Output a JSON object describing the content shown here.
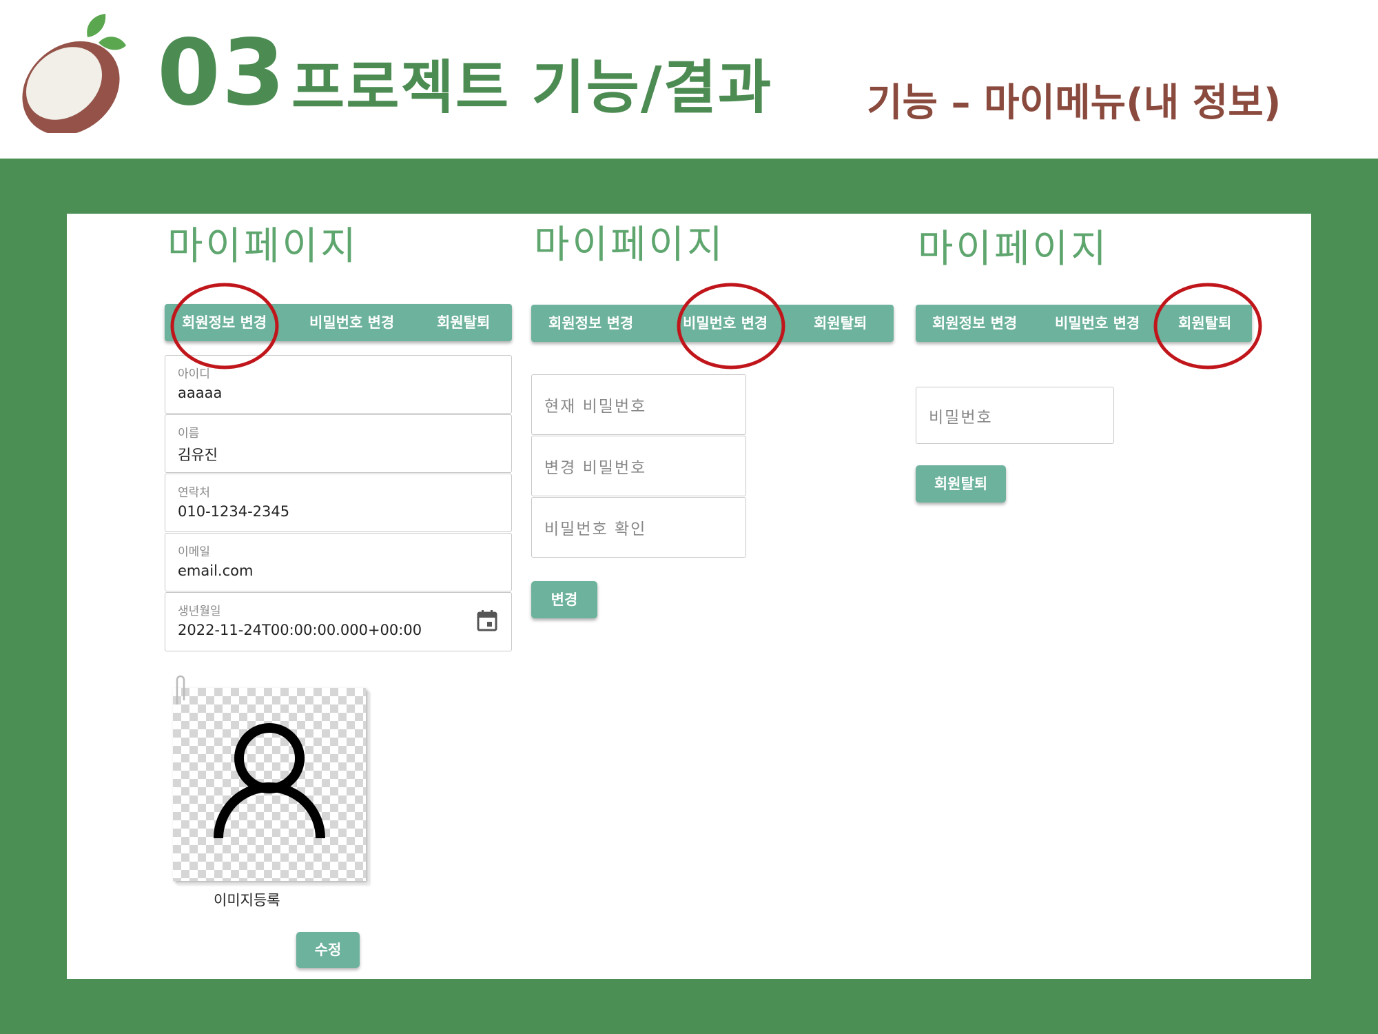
{
  "header": {
    "section_number": "03",
    "section_title": "프로젝트 기능/결과",
    "subtitle": "기능 – 마이메뉴(내 정보)"
  },
  "colors": {
    "brand_green": "#4c8f54",
    "accent_teal": "#6cb29c",
    "heading_green": "#5ea56e",
    "subtitle_brown": "#8a4a3e",
    "highlight_red": "#c0161b"
  },
  "screens": [
    {
      "heading": "마이페이지",
      "tabs": [
        "회원정보 변경",
        "비밀번호 변경",
        "회원탈퇴"
      ],
      "highlighted_tab": "회원정보 변경",
      "fields": [
        {
          "label": "아이디",
          "value": "aaaaa"
        },
        {
          "label": "이름",
          "value": "김유진"
        },
        {
          "label": "연락처",
          "value": "010-1234-2345"
        },
        {
          "label": "이메일",
          "value": "email.com"
        },
        {
          "label": "생년월일",
          "value": "2022-11-24T00:00:00.000+00:00",
          "icon": "calendar-icon"
        }
      ],
      "image_caption": "이미지등록",
      "image_icon": "user-avatar-icon",
      "submit_label": "수정"
    },
    {
      "heading": "마이페이지",
      "tabs": [
        "회원정보 변경",
        "비밀번호 변경",
        "회원탈퇴"
      ],
      "highlighted_tab": "비밀번호 변경",
      "password_fields": [
        "현재 비밀번호",
        "변경 비밀번호",
        "비밀번호 확인"
      ],
      "submit_label": "변경"
    },
    {
      "heading": "마이페이지",
      "tabs": [
        "회원정보 변경",
        "비밀번호 변경",
        "회원탈퇴"
      ],
      "highlighted_tab": "회원탈퇴",
      "password_placeholder": "비밀번호",
      "submit_label": "회원탈퇴"
    }
  ]
}
